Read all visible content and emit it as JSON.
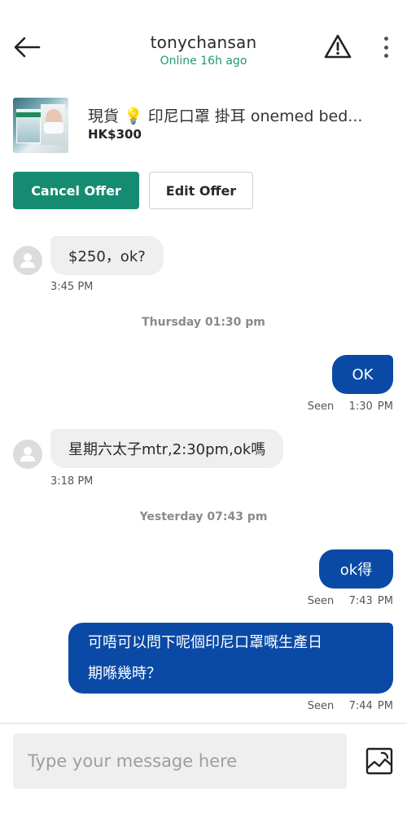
{
  "header": {
    "username": "tonychansan",
    "online_status": "Online 16h ago"
  },
  "product": {
    "title": "現貨 💡 印尼口罩 掛耳 onemed bed...",
    "price": "HK$300"
  },
  "actions": {
    "cancel_label": "Cancel Offer",
    "edit_label": "Edit Offer"
  },
  "messages": [
    {
      "direction": "in",
      "text": "$250，ok?",
      "time": "3:45 PM"
    },
    {
      "type": "separator",
      "text": "Thursday 01:30 pm"
    },
    {
      "direction": "out",
      "text": "OK",
      "status": "Seen",
      "time": "1:30 PM"
    },
    {
      "direction": "in",
      "text": "星期六太子mtr,2:30pm,ok嗎",
      "time": "3:18 PM"
    },
    {
      "type": "separator",
      "text": "Yesterday 07:43 pm"
    },
    {
      "direction": "out",
      "text": "ok得",
      "status": "Seen",
      "time": "7:43 PM"
    },
    {
      "direction": "out",
      "text_line1": "可唔可以問下呢個印尼口罩嘅生產日",
      "text_line2": "期喺幾時？",
      "status": "Seen",
      "time": "7:44 PM"
    }
  ],
  "composer": {
    "placeholder": "Type your message here"
  },
  "colors": {
    "brand_green": "#158c71",
    "online_green": "#1f9a78",
    "outgoing_bubble": "#0a4aa6",
    "incoming_bubble": "#efefef"
  },
  "icons": [
    "arrow-left-icon",
    "warning-triangle-icon",
    "more-vertical-icon",
    "user-avatar-icon",
    "image-upload-icon"
  ]
}
